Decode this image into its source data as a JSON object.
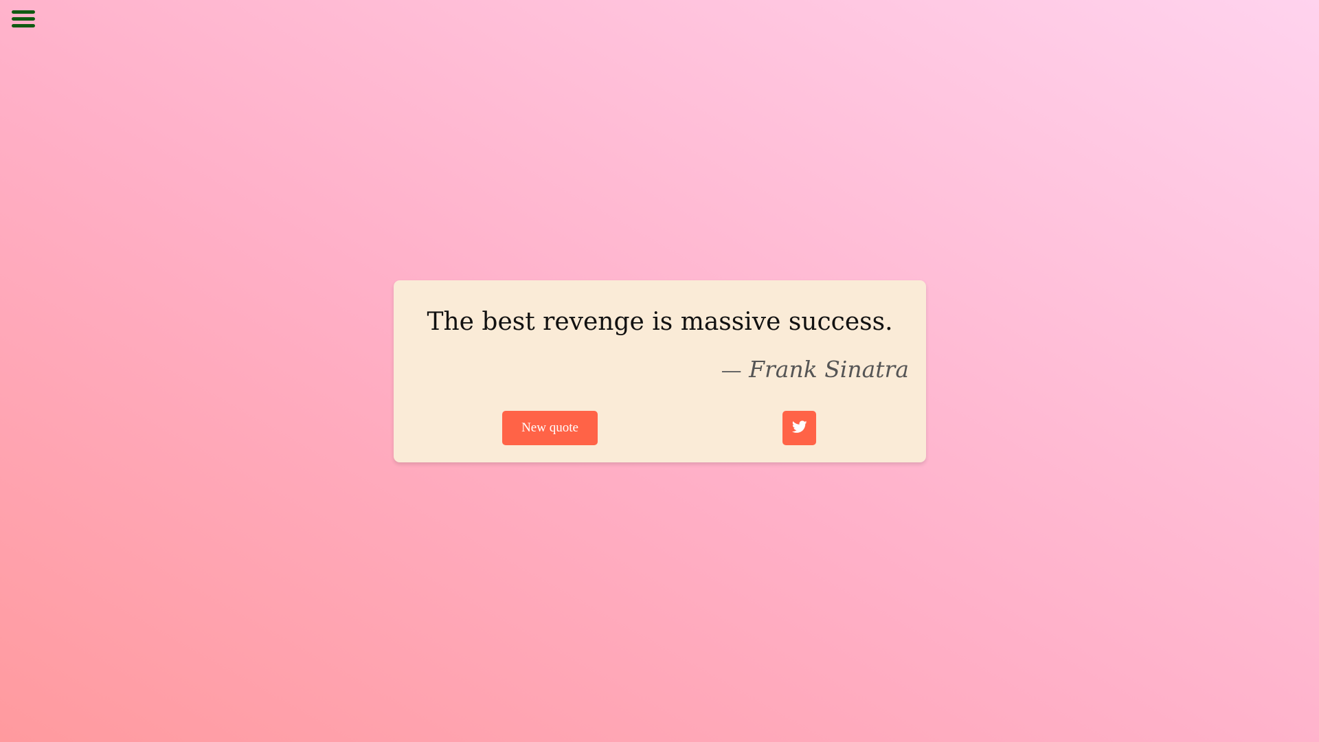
{
  "colors": {
    "background_gradient": [
      "#ff9a9e",
      "#ffb0c8",
      "#ffd3ee"
    ],
    "card_background": "#faebd7",
    "accent": "#ff6347",
    "menu_icon": "#0f5a12"
  },
  "nav": {
    "menu_icon": "hamburger-icon"
  },
  "quote": {
    "text": "The best revenge is massive success.",
    "author_dash": "—",
    "author": "Frank Sinatra"
  },
  "actions": {
    "new_quote_label": "New quote",
    "tweet_icon": "twitter-icon"
  }
}
